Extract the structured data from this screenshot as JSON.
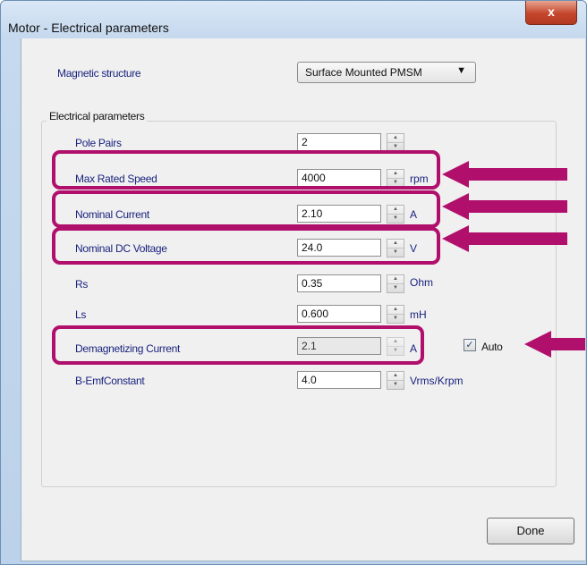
{
  "window": {
    "title": "Motor - Electrical parameters",
    "close_glyph": "x"
  },
  "magnetic": {
    "label": "Magnetic structure",
    "value": "Surface Mounted PMSM",
    "arrow": "▼"
  },
  "group": {
    "title": "Electrical parameters"
  },
  "params": [
    {
      "label": "Pole Pairs",
      "value": "2",
      "unit": ""
    },
    {
      "label": "Max Rated Speed",
      "value": "4000",
      "unit": "rpm"
    },
    {
      "label": "Nominal Current",
      "value": "2.10",
      "unit": "A"
    },
    {
      "label": "Nominal DC Voltage",
      "value": "24.0",
      "unit": "V"
    },
    {
      "label": "Rs",
      "value": "0.35",
      "unit": "Ohm"
    },
    {
      "label": "Ls",
      "value": "0.600",
      "unit": "mH"
    },
    {
      "label": "Demagnetizing Current",
      "value": "2.1",
      "unit": "A"
    },
    {
      "label": "B-EmfConstant",
      "value": "4.0",
      "unit": "Vrms/Krpm"
    }
  ],
  "auto": {
    "label": "Auto",
    "checked": true
  },
  "buttons": {
    "done": "Done"
  },
  "colors": {
    "highlight": "#b0106c",
    "label_text": "#1a237e"
  }
}
